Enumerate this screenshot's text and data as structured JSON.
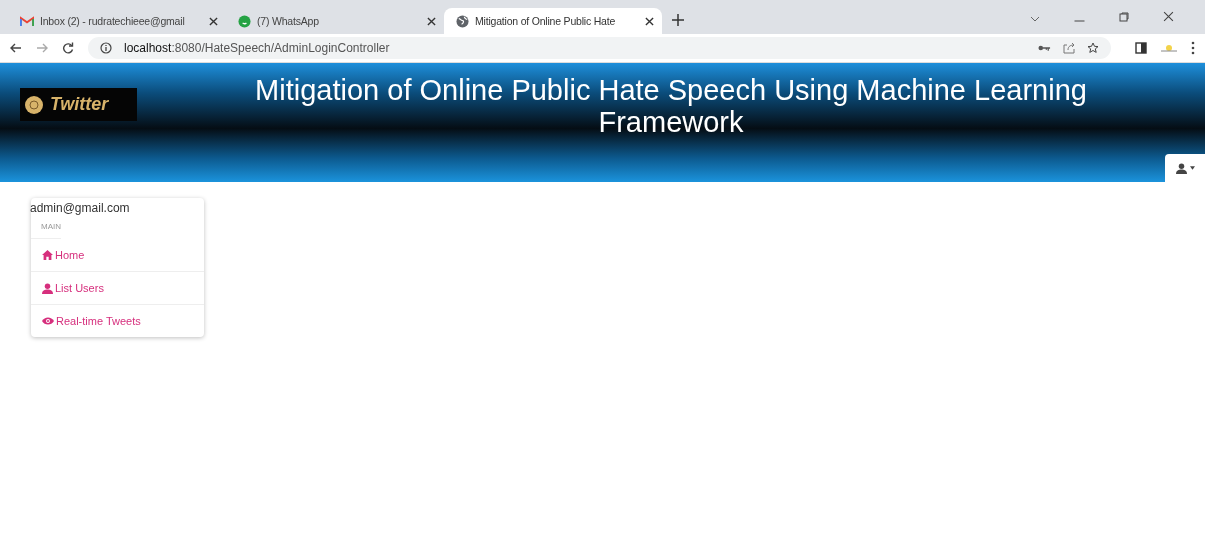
{
  "browser": {
    "tabs": [
      {
        "kind": "mail",
        "title": "Inbox (2) - rudratechieee@gmail",
        "selected": false
      },
      {
        "kind": "chat",
        "title": "(7) WhatsApp",
        "selected": false
      },
      {
        "kind": "globe",
        "title": "Mitigation of Online Public Hate",
        "selected": true
      }
    ],
    "address": {
      "host": "localhost",
      "path": ":8080/HateSpeech/AdminLoginController"
    }
  },
  "header": {
    "logo": "Twitter",
    "title": "Mitigation of Online Public Hate Speech Using Machine Learning Framework"
  },
  "sidebar": {
    "user": "admin@gmail.com",
    "section": "MAIN",
    "items": [
      {
        "kind": "home",
        "label": "Home"
      },
      {
        "kind": "user",
        "label": "List Users"
      },
      {
        "kind": "eye",
        "label": "Real-time Tweets"
      }
    ]
  }
}
